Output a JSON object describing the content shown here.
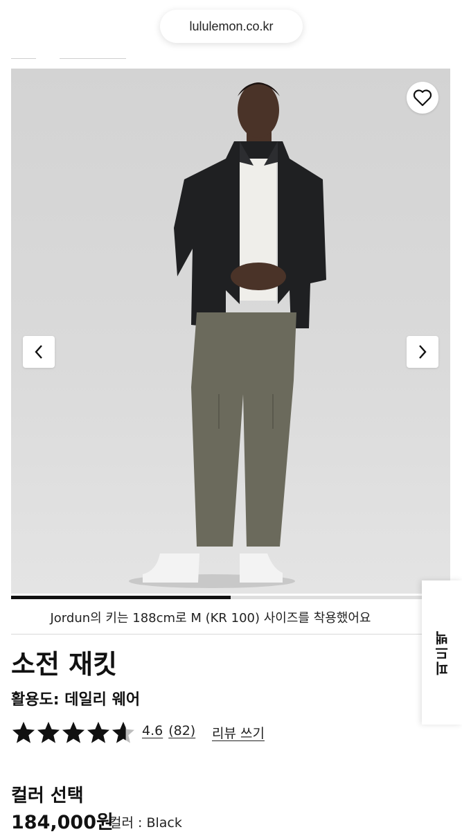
{
  "browser": {
    "url": "lululemon.co.kr"
  },
  "product": {
    "model_caption": "Jordun의 키는 188cm로 M (KR 100) 사이즈를 착용했어요",
    "title": "소전 재킷",
    "usage_label": "활용도:",
    "usage_value": "데일리 웨어",
    "rating": "4.6",
    "review_count": "(82)",
    "write_review": "리뷰 쓰기",
    "rating_stars": 4.6,
    "color_heading": "컬러 선택",
    "price": "184,000원",
    "color_label": "컬러 :",
    "color_value": "Black"
  },
  "gallery": {
    "progress": 0.5,
    "prev_icon": "chevron-left-icon",
    "next_icon": "chevron-right-icon",
    "favorite_icon": "heart-icon"
  },
  "side_tab": {
    "label": "피드백"
  },
  "colors": {
    "text": "#111111",
    "hero_bg": "#d6d6d6",
    "jacket": "#1e1f21",
    "pants": "#6b6a5c"
  }
}
